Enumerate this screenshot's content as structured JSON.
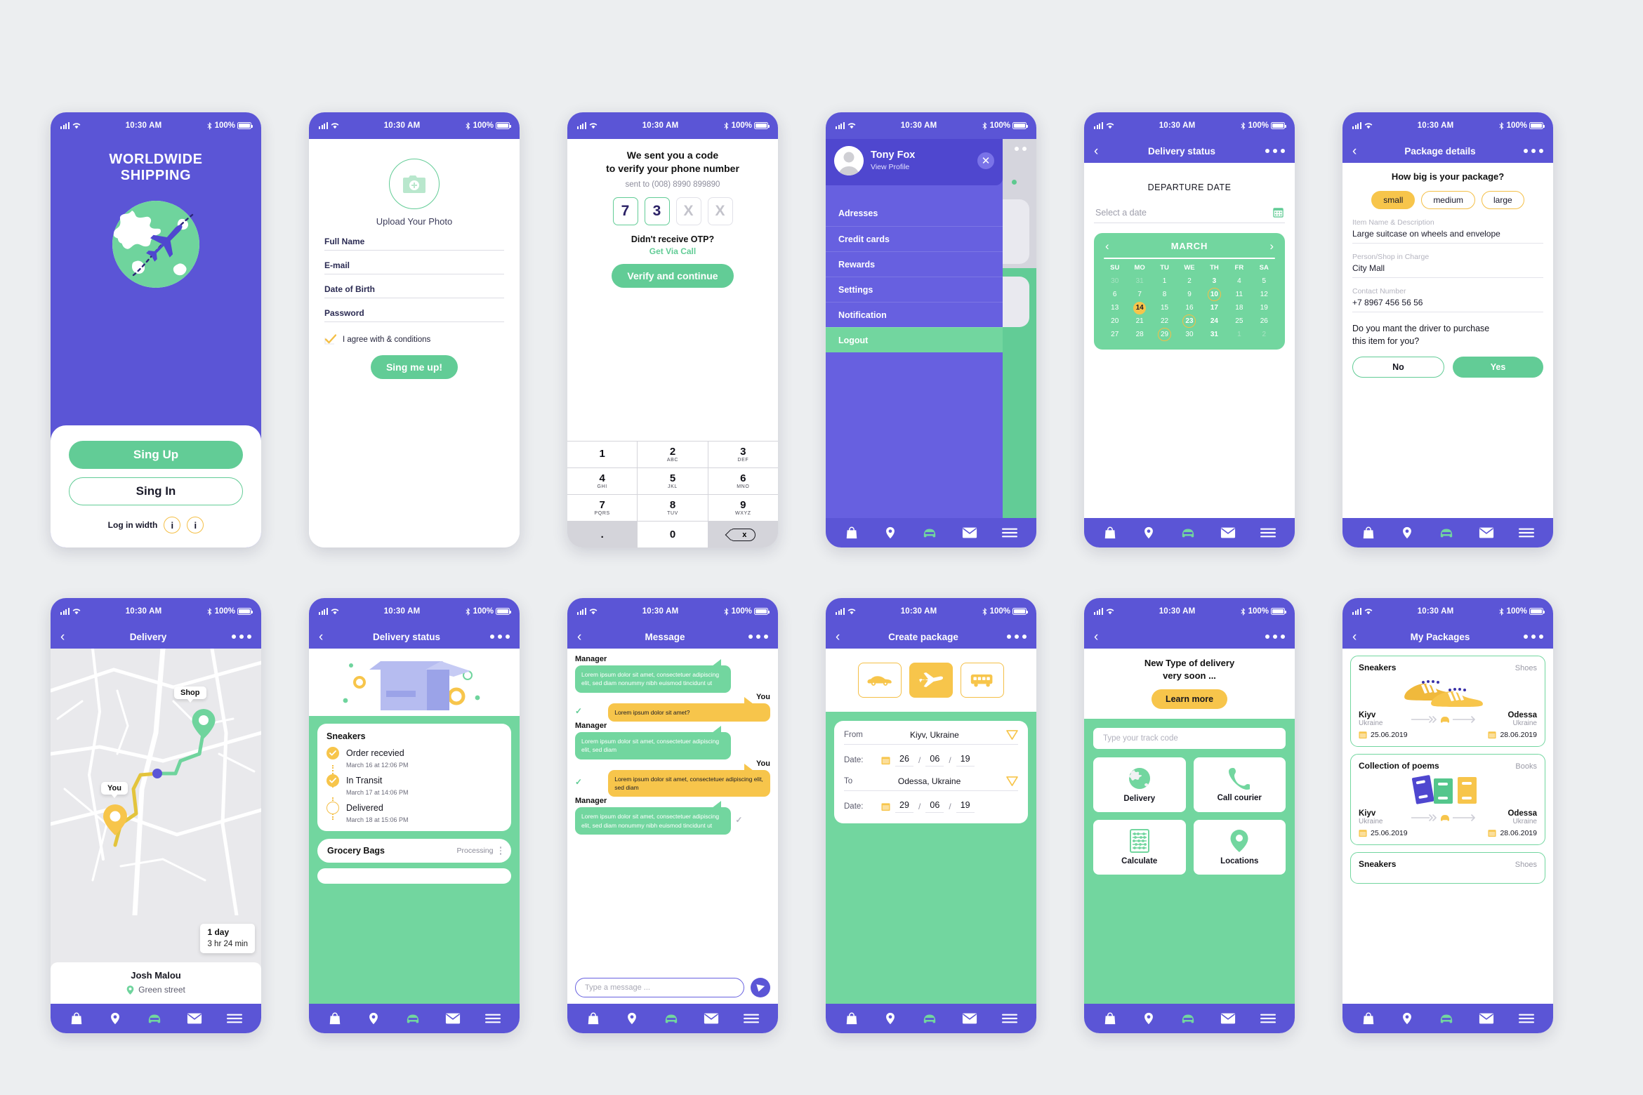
{
  "colors": {
    "purple": "#5b55d6",
    "green": "#62cc96",
    "green_light": "#72d69f",
    "yellow": "#f7c54b",
    "bg": "#eceef0"
  },
  "status_bar": {
    "time": "10:30 AM",
    "battery": "100%"
  },
  "tabbar": {
    "items": [
      "bag-icon",
      "location-pin-icon",
      "car-icon",
      "envelope-icon",
      "hamburger-icon"
    ]
  },
  "screens": {
    "welcome": {
      "title_line1": "WORLDWIDE",
      "title_line2": "SHIPPING",
      "sign_up": "Sing Up",
      "sign_in": "Sing In",
      "login_with": "Log in width",
      "social_1": "i",
      "social_2": "i"
    },
    "signup": {
      "upload_label": "Upload Your Photo",
      "fields": [
        {
          "label": "Full Name"
        },
        {
          "label": "E-mail"
        },
        {
          "label": "Date of Birth"
        },
        {
          "label": "Password"
        }
      ],
      "agree": "I agree with & conditions",
      "submit": "Sing me up!"
    },
    "otp": {
      "heading_line1": "We sent you a code",
      "heading_line2": "to verify your phone number",
      "sent_to": "sent to (008) 8990 899890",
      "digits": [
        {
          "value": "7",
          "state": "filled"
        },
        {
          "value": "3",
          "state": "filled"
        },
        {
          "value": "X",
          "state": "empty"
        },
        {
          "value": "X",
          "state": "empty"
        }
      ],
      "didnt_receive": "Didn't receive OTP?",
      "get_via_call": "Get Via Call",
      "verify": "Verify and continue",
      "keypad": [
        {
          "num": "1",
          "abc": ""
        },
        {
          "num": "2",
          "abc": "ABC"
        },
        {
          "num": "3",
          "abc": "DEF"
        },
        {
          "num": "4",
          "abc": "GHI"
        },
        {
          "num": "5",
          "abc": "JKL"
        },
        {
          "num": "6",
          "abc": "MNO"
        },
        {
          "num": "7",
          "abc": "PQRS"
        },
        {
          "num": "8",
          "abc": "TUV"
        },
        {
          "num": "9",
          "abc": "WXYZ"
        },
        {
          "num": ".",
          "abc": ""
        },
        {
          "num": "0",
          "abc": ""
        },
        {
          "num": "x",
          "abc": ""
        }
      ]
    },
    "menu": {
      "user_name": "Tony Fox",
      "view_profile": "View Profile",
      "close": "✕",
      "items": [
        {
          "label": "Adresses"
        },
        {
          "label": "Credit cards"
        },
        {
          "label": "Rewards"
        },
        {
          "label": "Settings"
        },
        {
          "label": "Notification"
        },
        {
          "label": "Logout"
        }
      ]
    },
    "departure": {
      "nav_title": "Delivery status",
      "heading": "DEPARTURE DATE",
      "select_placeholder": "Select a date",
      "month": "MARCH",
      "dow": [
        "SU",
        "MO",
        "TU",
        "WE",
        "TH",
        "FR",
        "SA"
      ],
      "weeks": [
        [
          {
            "d": "30",
            "s": "mut"
          },
          {
            "d": "31",
            "s": "mut"
          },
          {
            "d": "1",
            "s": ""
          },
          {
            "d": "2",
            "s": ""
          },
          {
            "d": "3",
            "s": "bold"
          },
          {
            "d": "4",
            "s": ""
          },
          {
            "d": "5",
            "s": ""
          }
        ],
        [
          {
            "d": "6",
            "s": ""
          },
          {
            "d": "7",
            "s": ""
          },
          {
            "d": "8",
            "s": ""
          },
          {
            "d": "9",
            "s": ""
          },
          {
            "d": "10",
            "s": "bold ring"
          },
          {
            "d": "11",
            "s": ""
          },
          {
            "d": "12",
            "s": ""
          }
        ],
        [
          {
            "d": "13",
            "s": ""
          },
          {
            "d": "14",
            "s": "sel"
          },
          {
            "d": "15",
            "s": ""
          },
          {
            "d": "16",
            "s": ""
          },
          {
            "d": "17",
            "s": "bold"
          },
          {
            "d": "18",
            "s": ""
          },
          {
            "d": "19",
            "s": ""
          }
        ],
        [
          {
            "d": "20",
            "s": ""
          },
          {
            "d": "21",
            "s": ""
          },
          {
            "d": "22",
            "s": ""
          },
          {
            "d": "23",
            "s": "bold ring"
          },
          {
            "d": "24",
            "s": "bold"
          },
          {
            "d": "25",
            "s": ""
          },
          {
            "d": "26",
            "s": ""
          }
        ],
        [
          {
            "d": "27",
            "s": ""
          },
          {
            "d": "28",
            "s": ""
          },
          {
            "d": "29",
            "s": "ring"
          },
          {
            "d": "30",
            "s": ""
          },
          {
            "d": "31",
            "s": "bold"
          },
          {
            "d": "1",
            "s": "mut"
          },
          {
            "d": "2",
            "s": "mut"
          }
        ]
      ]
    },
    "package_details": {
      "nav_title": "Package details",
      "question": "How big is your package?",
      "sizes": [
        {
          "label": "small",
          "selected": true
        },
        {
          "label": "medium",
          "selected": false
        },
        {
          "label": "large",
          "selected": false
        }
      ],
      "fields": [
        {
          "label": "Item Name & Description",
          "value": "Large suitcase on wheels and envelope"
        },
        {
          "label": "Person/Shop in Charge",
          "value": "City Mall"
        },
        {
          "label": "Contact Number",
          "value": "+7 8967 456 56 56"
        }
      ],
      "question2_line1": "Do you mant the driver to purchase",
      "question2_line2": "this item for you?",
      "no": "No",
      "yes": "Yes"
    },
    "delivery_map": {
      "nav_title": "Delivery",
      "shop_label": "Shop",
      "you_label": "You",
      "eta_days": "1 day",
      "eta_time": "3 hr  24 min",
      "courier_name": "Josh Malou",
      "courier_street": "Green street"
    },
    "delivery_status": {
      "nav_title": "Delivery status",
      "card_title": "Sneakers",
      "steps": [
        {
          "status": "Order recevied",
          "date": "March 16 at 12:06 PM",
          "done": true
        },
        {
          "status": "In Transit",
          "date": "March 17 at 14:06 PM",
          "done": true
        },
        {
          "status": "Delivered",
          "date": "March 18 at 15:06 PM",
          "done": false
        }
      ],
      "second_row_title": "Grocery Bags",
      "second_row_status": "Processing"
    },
    "message": {
      "nav_title": "Message",
      "bubbles": [
        {
          "who": "Manager",
          "side": "left",
          "text": "Lorem ipsum dolor sit amet, consectetuer adipiscing elit, sed diam nonummy nibh euismod tincidunt ut",
          "tick": "none"
        },
        {
          "who": "You",
          "side": "right",
          "text": "Lorem ipsum dolor sit amet?",
          "tick": "green"
        },
        {
          "who": "Manager",
          "side": "left",
          "text": "Lorem ipsum dolor sit amet, consectetuer adipiscing elit, sed diam",
          "tick": "none"
        },
        {
          "who": "You",
          "side": "right",
          "text": "Lorem ipsum dolor sit amet, consectetuer adipiscing elit, sed diam",
          "tick": "green"
        },
        {
          "who": "Manager",
          "side": "left",
          "text": "Lorem ipsum dolor sit amet, consectetuer adipiscing elit, sed diam nonummy nibh euismod tincidunt ut",
          "tick": "grey"
        }
      ],
      "composer_placeholder": "Type a message ..."
    },
    "create_package": {
      "nav_title": "Create package",
      "modes": [
        {
          "icon": "car-icon",
          "selected": false
        },
        {
          "icon": "plane-icon",
          "selected": true
        },
        {
          "icon": "bus-icon",
          "selected": false
        }
      ],
      "from_label": "From",
      "from_value": "Kiyv, Ukraine",
      "from_date_label": "Date:",
      "from_date": {
        "dd": "26",
        "mm": "06",
        "yy": "19"
      },
      "to_label": "To",
      "to_value": "Odessa, Ukraine",
      "to_date_label": "Date:",
      "to_date": {
        "dd": "29",
        "mm": "06",
        "yy": "19"
      }
    },
    "new_delivery": {
      "promo_line1": "New Type of delivery",
      "promo_line2": "very soon ...",
      "learn_more": "Learn more",
      "track_placeholder": "Type your track code",
      "tiles": [
        {
          "label": "Delivery",
          "icon": "globe-icon"
        },
        {
          "label": "Call courier",
          "icon": "phone-icon"
        },
        {
          "label": "Calculate",
          "icon": "abacus-icon"
        },
        {
          "label": "Locations",
          "icon": "location-pin-icon"
        }
      ]
    },
    "my_packages": {
      "nav_title": "My Packages",
      "packages": [
        {
          "title": "Sneakers",
          "category": "Shoes",
          "from_city": "Kiyv",
          "from_country": "Ukraine",
          "from_date": "25.06.2019",
          "to_city": "Odessa",
          "to_country": "Ukraine",
          "to_date": "28.06.2019",
          "art": "sneakers"
        },
        {
          "title": "Collection of poems",
          "category": "Books",
          "from_city": "Kiyv",
          "from_country": "Ukraine",
          "from_date": "25.06.2019",
          "to_city": "Odessa",
          "to_country": "Ukraine",
          "to_date": "28.06.2019",
          "art": "books"
        },
        {
          "title": "Sneakers",
          "category": "Shoes",
          "from_city": "",
          "from_country": "",
          "from_date": "",
          "to_city": "",
          "to_country": "",
          "to_date": "",
          "art": "none"
        }
      ]
    }
  }
}
